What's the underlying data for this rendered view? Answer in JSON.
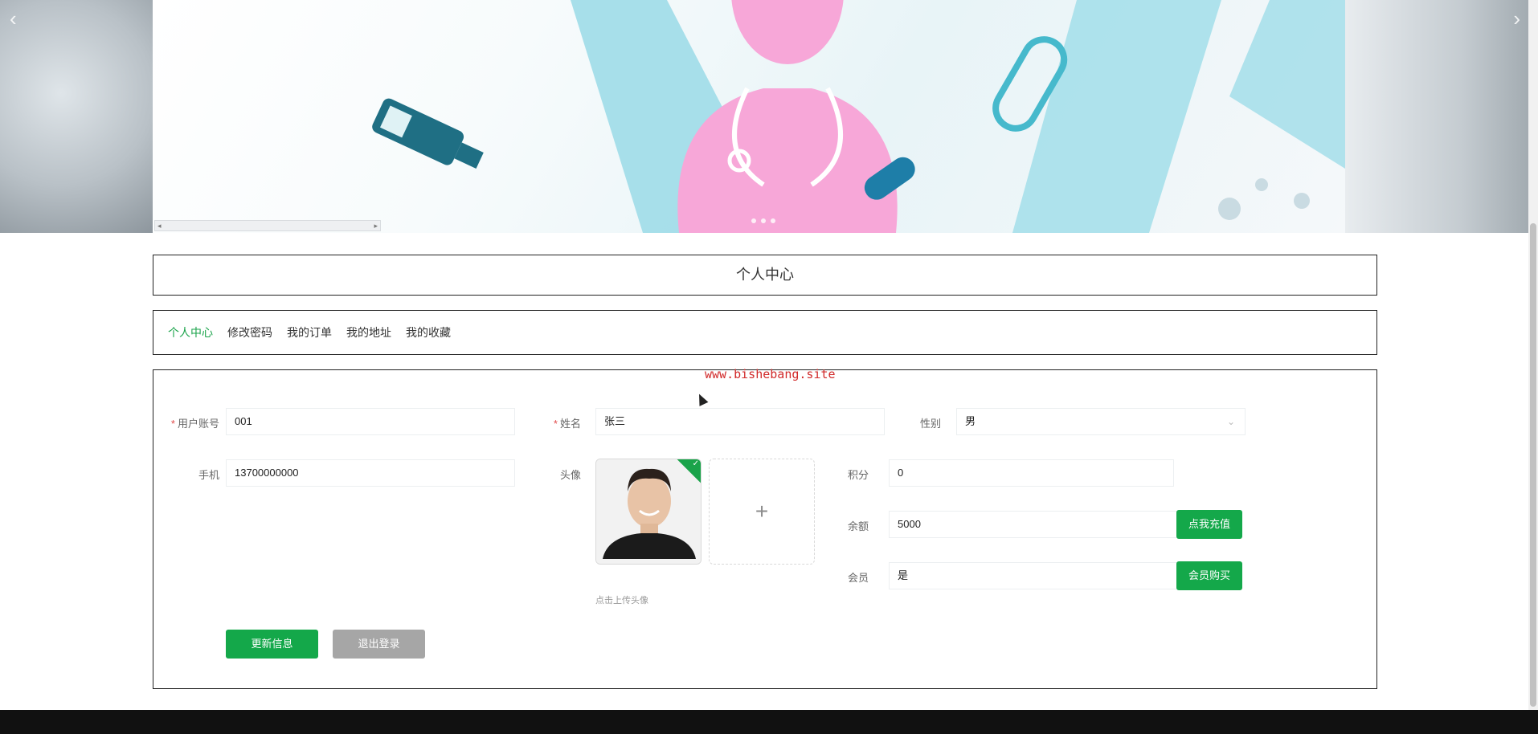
{
  "page": {
    "title": "个人中心",
    "watermark": "www.bishebang.site"
  },
  "tabs": [
    {
      "label": "个人中心",
      "active": true
    },
    {
      "label": "修改密码",
      "active": false
    },
    {
      "label": "我的订单",
      "active": false
    },
    {
      "label": "我的地址",
      "active": false
    },
    {
      "label": "我的收藏",
      "active": false
    }
  ],
  "form": {
    "account_label": "用户账号",
    "account_value": "001",
    "name_label": "姓名",
    "name_value": "张三",
    "gender_label": "性别",
    "gender_value": "男",
    "phone_label": "手机",
    "phone_value": "13700000000",
    "avatar_label": "头像",
    "upload_hint": "点击上传头像",
    "points_label": "积分",
    "points_value": "0",
    "balance_label": "余额",
    "balance_value": "5000",
    "recharge_button": "点我充值",
    "member_label": "会员",
    "member_value": "是",
    "member_buy_button": "会员购买",
    "update_button": "更新信息",
    "logout_button": "退出登录",
    "required_mark": "*"
  },
  "banner": {
    "prev_arrow": "‹",
    "next_arrow": "›",
    "scroll_left": "◂",
    "scroll_right": "▸"
  },
  "colors": {
    "accent": "#14a84a",
    "active_tab": "#1aa34a",
    "watermark": "#d12a2a",
    "secondary_button": "#a6a6a6"
  }
}
